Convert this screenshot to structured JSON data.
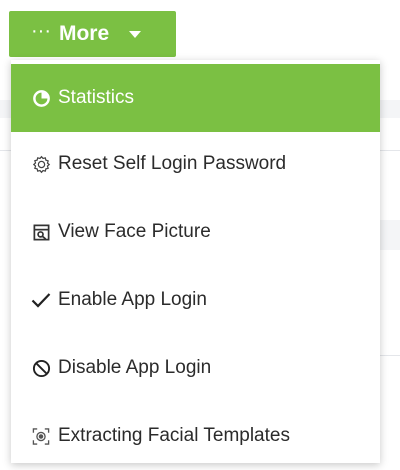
{
  "more_button": {
    "dots": "···",
    "label": "More"
  },
  "menu": {
    "items": [
      {
        "label": "Statistics",
        "icon": "pie-chart-icon",
        "active": true
      },
      {
        "label": "Reset Self Login Password",
        "icon": "gear-icon",
        "active": false
      },
      {
        "label": "View Face Picture",
        "icon": "face-picture-icon",
        "active": false
      },
      {
        "label": "Enable App Login",
        "icon": "checkmark-icon",
        "active": false
      },
      {
        "label": "Disable App Login",
        "icon": "prohibited-icon",
        "active": false
      },
      {
        "label": "Extracting Facial Templates",
        "icon": "face-scan-icon",
        "active": false
      }
    ]
  },
  "colors": {
    "accent": "#7bc043",
    "text": "#2b2b2b"
  }
}
